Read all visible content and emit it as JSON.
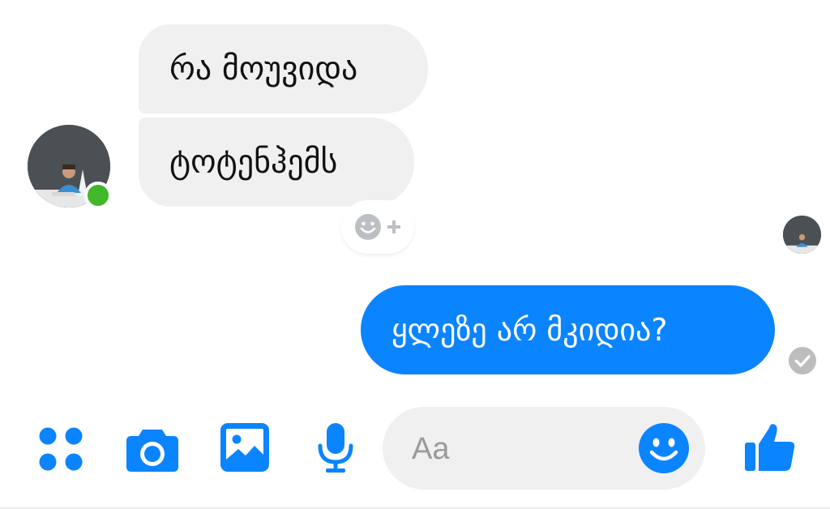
{
  "conversation": {
    "incoming": [
      {
        "text": "რა მოუვიდა"
      },
      {
        "text": "ტოტენჰემს"
      }
    ],
    "outgoing": [
      {
        "text": "ყლეზე არ მკიდია?"
      }
    ]
  },
  "composer": {
    "placeholder": "Aa"
  },
  "colors": {
    "accent": "#0b84ff",
    "incoming_bubble": "#f1f0f0",
    "online_indicator": "#42b72a",
    "seen_check": "#bdbdbd"
  },
  "icons": {
    "more": "grid-dots-icon",
    "camera": "camera-icon",
    "gallery": "image-icon",
    "voice": "microphone-icon",
    "emoji": "smiley-icon",
    "like": "thumbs-up-icon",
    "reaction": "add-reaction-icon",
    "status": "check-circle-icon"
  }
}
